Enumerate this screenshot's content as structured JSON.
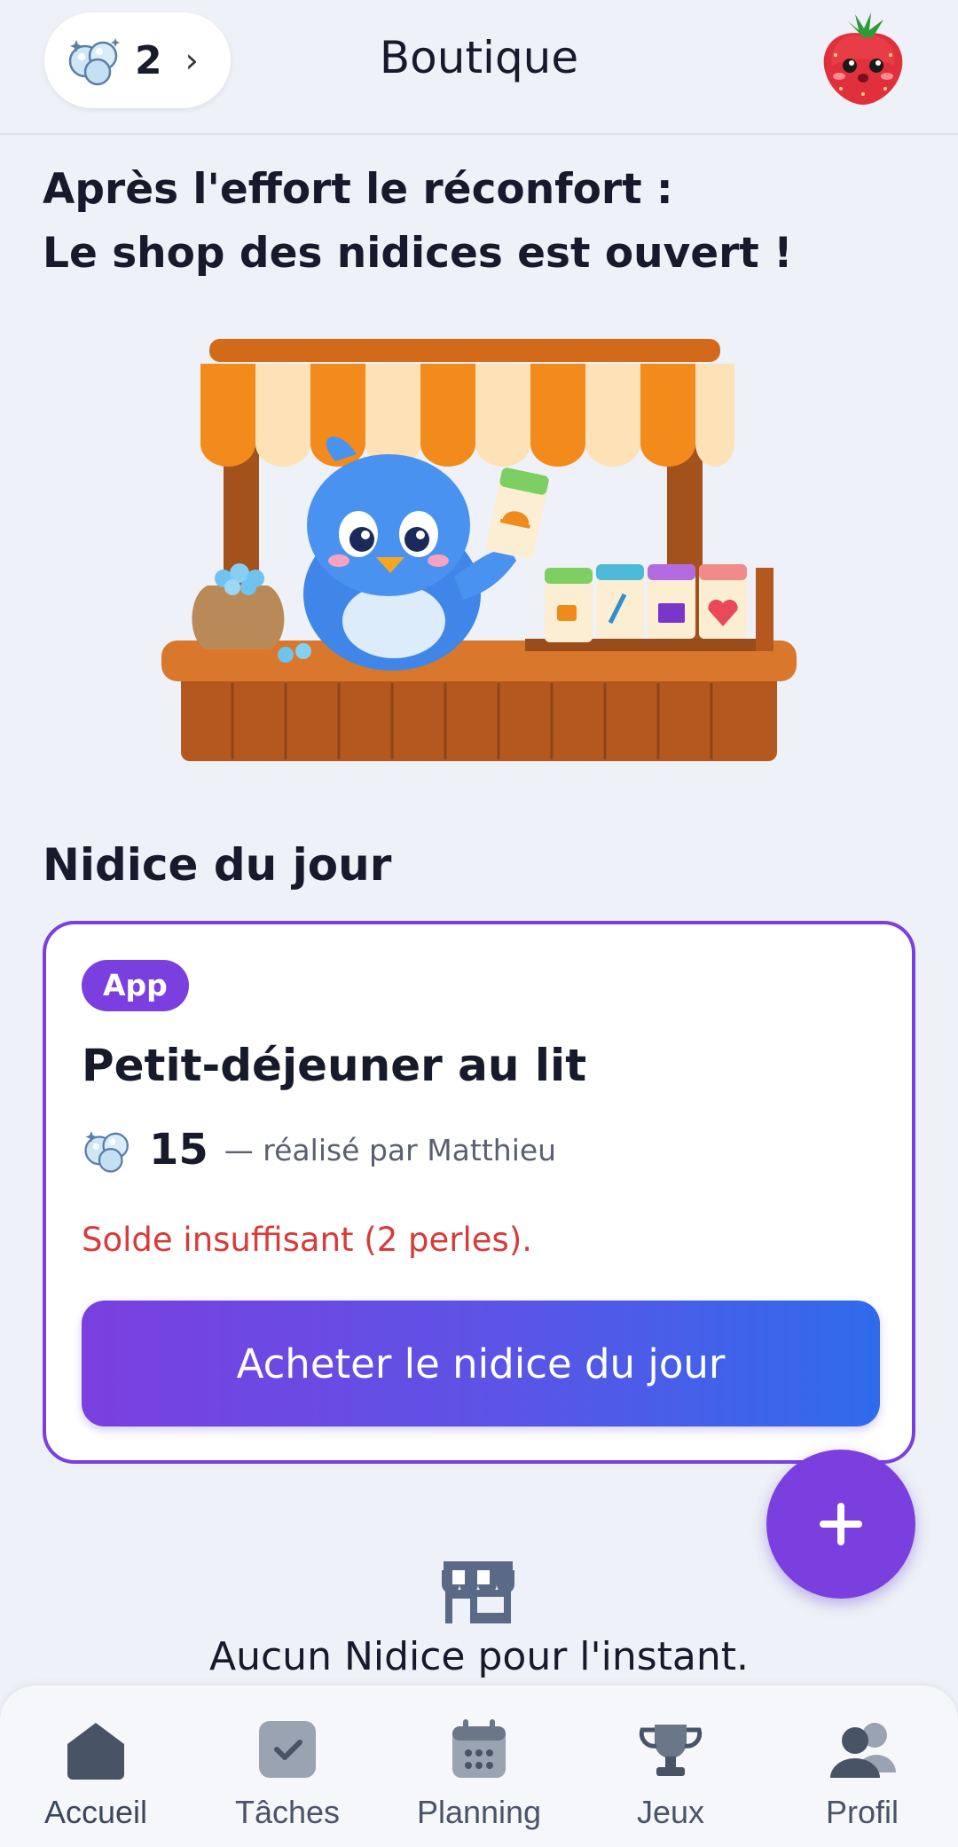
{
  "header": {
    "pearl_count": "2",
    "title": "Boutique"
  },
  "headline": {
    "line1": "Après l'effort le réconfort :",
    "line2": "Le shop des nidices est ouvert !"
  },
  "daily": {
    "section_title": "Nidice du jour",
    "badge": "App",
    "title": "Petit-déjeuner au lit",
    "price": "15",
    "by": "— réalisé par Matthieu",
    "warning": "Solde insuffisant (2 perles).",
    "buy_label": "Acheter le nidice du jour"
  },
  "empty": {
    "text": "Aucun Nidice pour l'instant."
  },
  "nav": [
    {
      "label": "Accueil",
      "icon": "home-icon"
    },
    {
      "label": "Tâches",
      "icon": "check-icon"
    },
    {
      "label": "Planning",
      "icon": "calendar-icon"
    },
    {
      "label": "Jeux",
      "icon": "trophy-icon"
    },
    {
      "label": "Profil",
      "icon": "users-icon"
    }
  ],
  "colors": {
    "accent": "#7b3fe0",
    "gradient_end": "#2f6bec",
    "warning": "#d93a3a",
    "background": "#eef1f7"
  }
}
